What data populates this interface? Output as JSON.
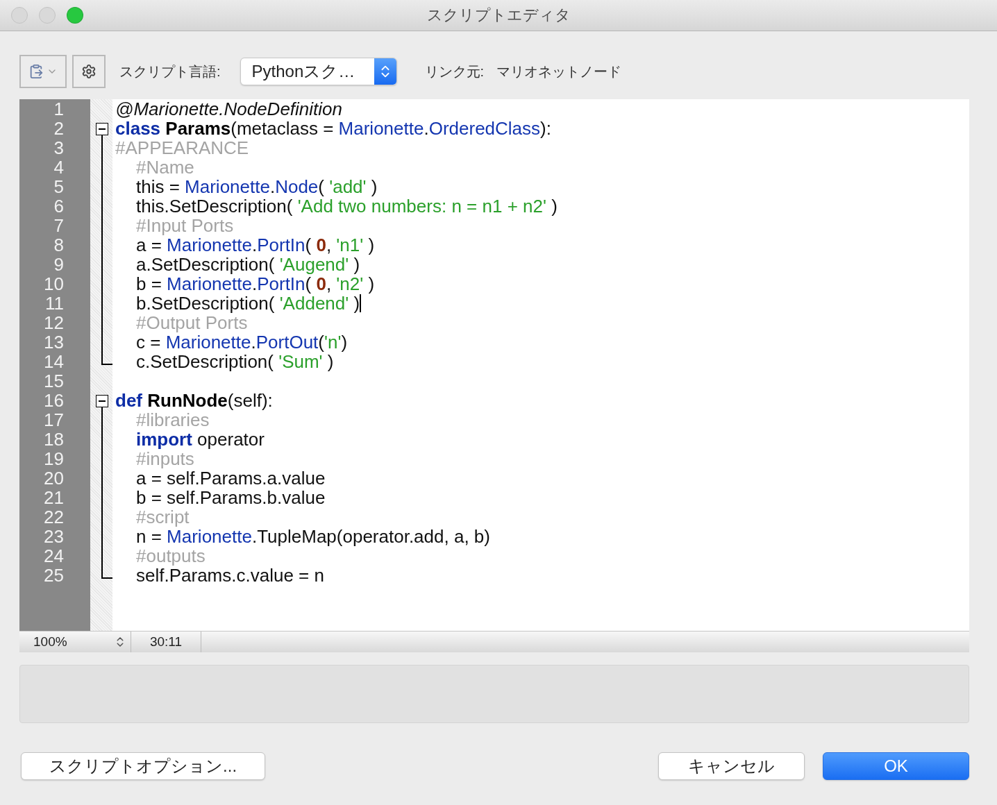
{
  "window": {
    "title": "スクリプトエディタ",
    "traffic_lights": [
      {
        "kind": "close",
        "active": false
      },
      {
        "kind": "minimize",
        "active": false
      },
      {
        "kind": "zoom",
        "active": true
      }
    ]
  },
  "toolbar": {
    "language_label": "スクリプト言語:",
    "language_value": "Pythonスク…",
    "link_label": "リンク元:",
    "link_value": "マリオネットノード"
  },
  "editor": {
    "lines": [
      {
        "number": "1",
        "indented": false,
        "tokens": [
          {
            "kind": "decorator",
            "t": "@Marionette.NodeDefinition"
          }
        ]
      },
      {
        "number": "2",
        "indented": false,
        "kind": "opener",
        "tokens": [
          {
            "kind": "keyword",
            "t": "class "
          },
          {
            "kind": "name",
            "t": "Params"
          },
          {
            "kind": "plain",
            "t": "(metaclass = "
          },
          {
            "kind": "ref",
            "t": "Marionette"
          },
          {
            "kind": "plain",
            "t": "."
          },
          {
            "kind": "ref",
            "t": "OrderedClass"
          },
          {
            "kind": "plain",
            "t": "):"
          }
        ]
      },
      {
        "number": "3",
        "indented": false,
        "kind": "inside",
        "tokens": [
          {
            "kind": "comment",
            "t": "#APPEARANCE"
          }
        ]
      },
      {
        "number": "4",
        "indented": true,
        "kind": "inside",
        "tokens": [
          {
            "kind": "comment",
            "t": "#Name"
          }
        ]
      },
      {
        "number": "5",
        "indented": true,
        "kind": "inside",
        "tokens": [
          {
            "kind": "plain",
            "t": "this = "
          },
          {
            "kind": "ref",
            "t": "Marionette"
          },
          {
            "kind": "plain",
            "t": "."
          },
          {
            "kind": "ref",
            "t": "Node"
          },
          {
            "kind": "plain",
            "t": "( "
          },
          {
            "kind": "string",
            "t": "'add'"
          },
          {
            "kind": "plain",
            "t": " )"
          }
        ]
      },
      {
        "number": "6",
        "indented": true,
        "kind": "inside",
        "tokens": [
          {
            "kind": "plain",
            "t": "this.SetDescription( "
          },
          {
            "kind": "string",
            "t": "'Add two numbers: n = n1 + n2'"
          },
          {
            "kind": "plain",
            "t": " )"
          }
        ]
      },
      {
        "number": "7",
        "indented": true,
        "kind": "inside",
        "tokens": [
          {
            "kind": "comment",
            "t": "#Input Ports"
          }
        ]
      },
      {
        "number": "8",
        "indented": true,
        "kind": "inside",
        "tokens": [
          {
            "kind": "plain",
            "t": "a = "
          },
          {
            "kind": "ref",
            "t": "Marionette"
          },
          {
            "kind": "plain",
            "t": "."
          },
          {
            "kind": "ref",
            "t": "PortIn"
          },
          {
            "kind": "plain",
            "t": "( "
          },
          {
            "kind": "number",
            "t": "0"
          },
          {
            "kind": "plain",
            "t": ", "
          },
          {
            "kind": "string",
            "t": "'n1'"
          },
          {
            "kind": "plain",
            "t": " )"
          }
        ]
      },
      {
        "number": "9",
        "indented": true,
        "kind": "inside",
        "tokens": [
          {
            "kind": "plain",
            "t": "a.SetDescription( "
          },
          {
            "kind": "string",
            "t": "'Augend'"
          },
          {
            "kind": "plain",
            "t": " )"
          }
        ]
      },
      {
        "number": "10",
        "indented": true,
        "kind": "inside",
        "tokens": [
          {
            "kind": "plain",
            "t": "b = "
          },
          {
            "kind": "ref",
            "t": "Marionette"
          },
          {
            "kind": "plain",
            "t": "."
          },
          {
            "kind": "ref",
            "t": "PortIn"
          },
          {
            "kind": "plain",
            "t": "( "
          },
          {
            "kind": "number",
            "t": "0"
          },
          {
            "kind": "plain",
            "t": ", "
          },
          {
            "kind": "string",
            "t": "'n2'"
          },
          {
            "kind": "plain",
            "t": " )"
          }
        ]
      },
      {
        "number": "11",
        "indented": true,
        "kind": "inside",
        "caret": true,
        "tokens": [
          {
            "kind": "plain",
            "t": "b.SetDescription( "
          },
          {
            "kind": "string",
            "t": "'Addend'"
          },
          {
            "kind": "plain",
            "t": " )"
          }
        ]
      },
      {
        "number": "12",
        "indented": true,
        "kind": "inside",
        "tokens": [
          {
            "kind": "comment",
            "t": "#Output Ports"
          }
        ]
      },
      {
        "number": "13",
        "indented": true,
        "kind": "inside",
        "tokens": [
          {
            "kind": "plain",
            "t": "c = "
          },
          {
            "kind": "ref",
            "t": "Marionette"
          },
          {
            "kind": "plain",
            "t": "."
          },
          {
            "kind": "ref",
            "t": "PortOut"
          },
          {
            "kind": "plain",
            "t": "("
          },
          {
            "kind": "string",
            "t": "'n'"
          },
          {
            "kind": "plain",
            "t": ")"
          }
        ]
      },
      {
        "number": "14",
        "indented": true,
        "kind": "closer",
        "tokens": [
          {
            "kind": "plain",
            "t": "c.SetDescription( "
          },
          {
            "kind": "string",
            "t": "'Sum'"
          },
          {
            "kind": "plain",
            "t": " )"
          }
        ]
      },
      {
        "number": "15"
      },
      {
        "number": "16",
        "indented": false,
        "kind": "opener",
        "tokens": [
          {
            "kind": "keyword",
            "t": "def "
          },
          {
            "kind": "name",
            "t": "RunNode"
          },
          {
            "kind": "plain",
            "t": "(self):"
          }
        ]
      },
      {
        "number": "17",
        "indented": true,
        "kind": "inside",
        "tokens": [
          {
            "kind": "comment",
            "t": "#libraries"
          }
        ]
      },
      {
        "number": "18",
        "indented": true,
        "kind": "inside",
        "tokens": [
          {
            "kind": "keyword",
            "t": "import"
          },
          {
            "kind": "plain",
            "t": " operator"
          }
        ]
      },
      {
        "number": "19",
        "indented": true,
        "kind": "inside",
        "tokens": [
          {
            "kind": "comment",
            "t": "#inputs"
          }
        ]
      },
      {
        "number": "20",
        "indented": true,
        "kind": "inside",
        "tokens": [
          {
            "kind": "plain",
            "t": "a = self.Params.a.value"
          }
        ]
      },
      {
        "number": "21",
        "indented": true,
        "kind": "inside",
        "tokens": [
          {
            "kind": "plain",
            "t": "b = self.Params.b.value"
          }
        ]
      },
      {
        "number": "22",
        "indented": true,
        "kind": "inside",
        "tokens": [
          {
            "kind": "comment",
            "t": "#script"
          }
        ]
      },
      {
        "number": "23",
        "indented": true,
        "kind": "inside",
        "tokens": [
          {
            "kind": "plain",
            "t": "n = "
          },
          {
            "kind": "ref",
            "t": "Marionette"
          },
          {
            "kind": "plain",
            "t": ".TupleMap(operator.add, a, b)"
          }
        ]
      },
      {
        "number": "24",
        "indented": true,
        "kind": "inside",
        "tokens": [
          {
            "kind": "comment",
            "t": "#outputs"
          }
        ]
      },
      {
        "number": "25",
        "indented": true,
        "kind": "closer",
        "tokens": [
          {
            "kind": "plain",
            "t": "self.Params.c.value = n"
          }
        ]
      }
    ]
  },
  "status_bar": {
    "zoom": "100%",
    "position": "30:11"
  },
  "buttons": [
    {
      "label": "スクリプトオプション...",
      "kind": "normal"
    },
    {
      "label": "キャンセル",
      "kind": "normal"
    },
    {
      "label": "OK",
      "kind": "default"
    }
  ]
}
